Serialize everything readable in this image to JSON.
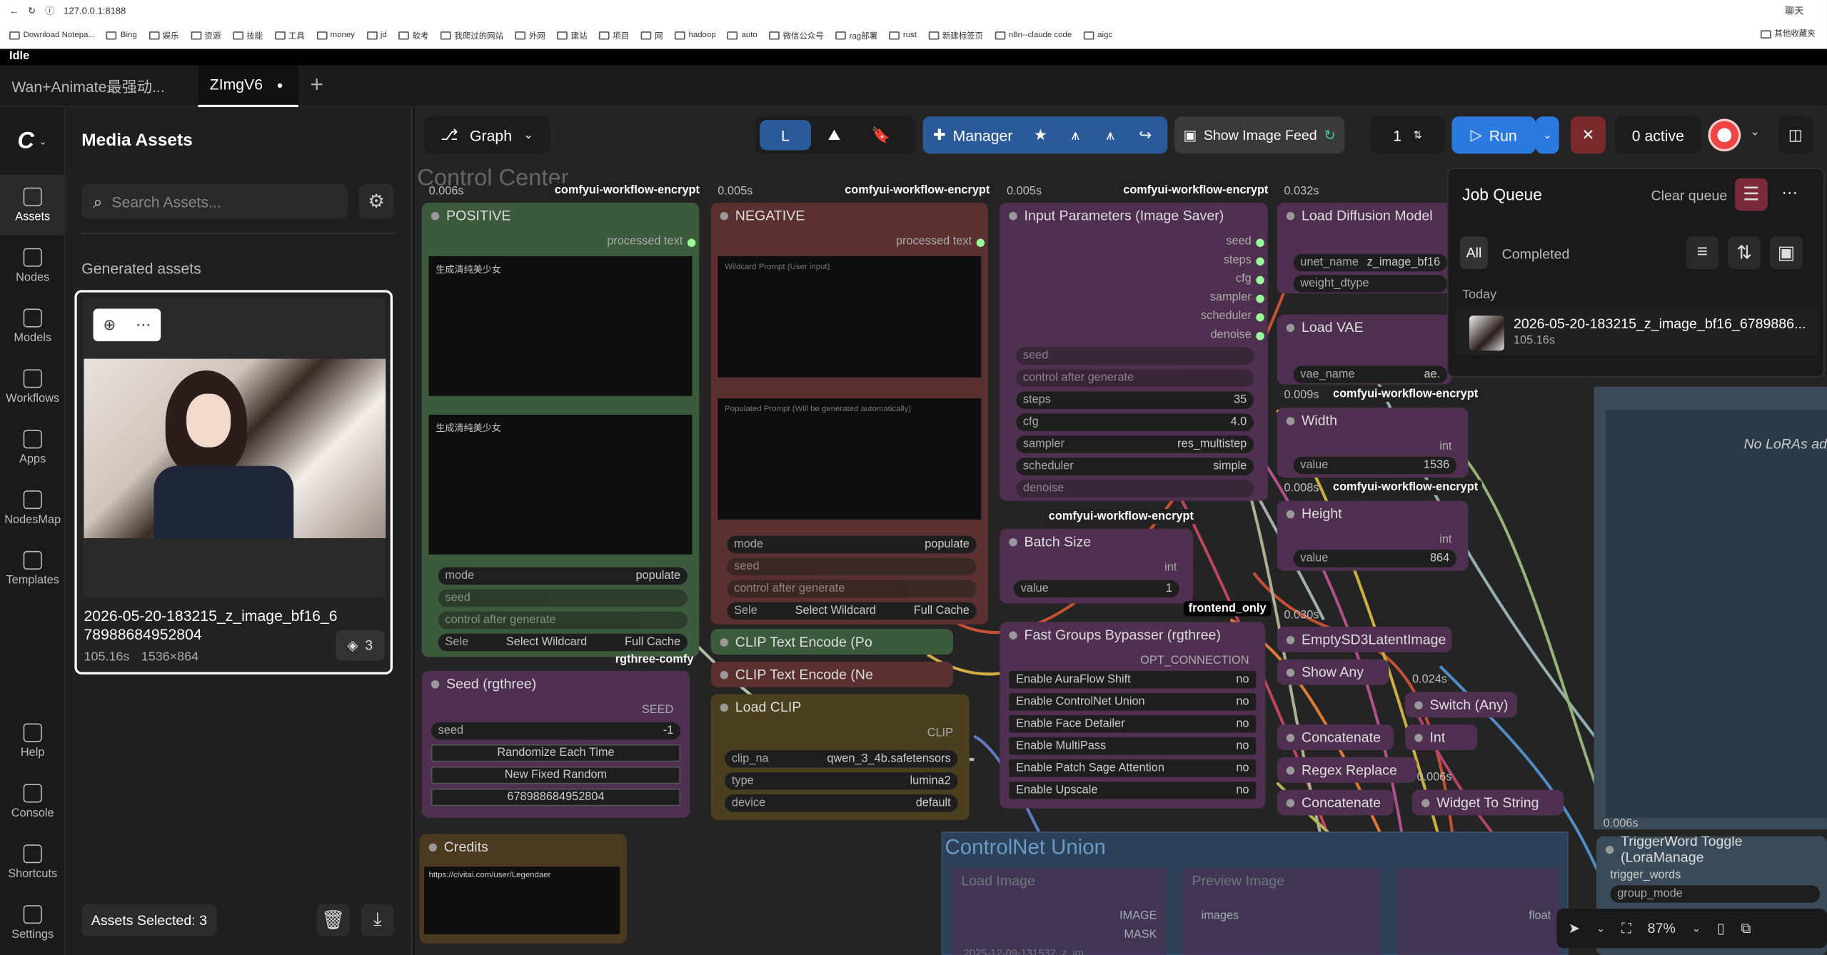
{
  "browser": {
    "url": "127.0.0.1:8188",
    "bookmarks": [
      "Download Notepa...",
      "Bing",
      "娱乐",
      "资源",
      "技能",
      "工具",
      "money",
      "jd",
      "软考",
      "我爬过的网站",
      "外网",
      "建站",
      "项目",
      "网",
      "hadoop",
      "auto",
      "微信公众号",
      "rag部署",
      "rust",
      "新建标签页",
      "n8n--claude code",
      "aigc"
    ],
    "other_bookmarks": "其他收藏夹",
    "profile": "聊天"
  },
  "status": "Idle",
  "tabs": [
    {
      "label": "Wan+Animate最强动...",
      "active": false
    },
    {
      "label": "ZImgV6",
      "active": true,
      "modified": "●"
    }
  ],
  "rail": [
    {
      "label": "Assets",
      "icon": "image-icon",
      "active": true
    },
    {
      "label": "Nodes",
      "icon": "nodes-icon"
    },
    {
      "label": "Models",
      "icon": "models-icon"
    },
    {
      "label": "Workflows",
      "icon": "workflows-icon"
    },
    {
      "label": "Apps",
      "icon": "apps-icon"
    },
    {
      "label": "NodesMap",
      "icon": "nodesmap-icon"
    },
    {
      "label": "Templates",
      "icon": "templates-icon"
    }
  ],
  "rail_bottom": [
    {
      "label": "Help",
      "icon": "help-icon"
    },
    {
      "label": "Console",
      "icon": "console-icon"
    },
    {
      "label": "Shortcuts",
      "icon": "keyboard-icon"
    },
    {
      "label": "Settings",
      "icon": "settings-icon"
    }
  ],
  "media": {
    "title": "Media Assets",
    "search_placeholder": "Search Assets...",
    "section": "Generated assets",
    "asset": {
      "name": "2026-05-20-183215_z_image_bf16_678988684952804",
      "time": "105.16s",
      "size": "1536×864",
      "count": "3"
    },
    "selected": "Assets Selected: 3"
  },
  "toolbar": {
    "graph": "Graph",
    "manager": "Manager",
    "image_feed": "Show Image Feed",
    "batch": "1",
    "run": "Run",
    "active": "0 active"
  },
  "queue": {
    "title": "Job Queue",
    "clear": "Clear queue",
    "tab_all": "All",
    "tab_completed": "Completed",
    "today": "Today",
    "job_name": "2026-05-20-183215_z_image_bf16_6789886...",
    "job_time": "105.16s"
  },
  "canvas": {
    "group_title": "Control Center",
    "controlnet_title": "ControlNet Union",
    "badge": "comfyui-workflow-encrypt",
    "positive": {
      "time": "0.006s",
      "title": "POSITIVE",
      "out": "processed text",
      "text1": "生成清纯美少女",
      "text2": "生成清纯美少女",
      "mode_label": "mode",
      "mode": "populate",
      "seed": "seed",
      "cag": "control after generate",
      "sel_label": "Sele",
      "sel": "Select Wildcard",
      "cache": "Full Cache"
    },
    "negative": {
      "time": "0.005s",
      "title": "NEGATIVE",
      "out": "processed text",
      "ph1": "Wildcard Prompt (User input)",
      "ph2": "Populated Prompt (Will be generated automatically)",
      "mode_label": "mode",
      "mode": "populate",
      "seed": "seed",
      "cag": "control after generate",
      "sel_label": "Sele",
      "sel": "Select Wildcard",
      "cache": "Full Cache"
    },
    "params": {
      "time": "0.005s",
      "title": "Input Parameters (Image Saver)",
      "outs": [
        "seed",
        "steps",
        "cfg",
        "sampler",
        "scheduler",
        "denoise"
      ],
      "seed": "seed",
      "cag": "control after generate",
      "steps": "35",
      "cfg": "4.0",
      "sampler": "res_multistep",
      "scheduler": "simple",
      "denoise": "denoise",
      "l_steps": "steps",
      "l_cfg": "cfg",
      "l_sampler": "sampler",
      "l_scheduler": "scheduler"
    },
    "diffusion": {
      "time": "0.032s",
      "title": "Load Diffusion Model",
      "unet_label": "unet_name",
      "unet": "z_image_bf16",
      "dtype": "weight_dtype"
    },
    "vae": {
      "title": "Load VAE",
      "label": "vae_name",
      "value": "ae."
    },
    "width": {
      "time": "0.009s",
      "title": "Width",
      "type": "int",
      "label": "value",
      "value": "1536"
    },
    "height": {
      "time": "0.008s",
      "title": "Height",
      "type": "int",
      "label": "value",
      "value": "864"
    },
    "batch": {
      "title": "Batch Size",
      "type": "int",
      "label": "value",
      "value": "1"
    },
    "seed_node": {
      "title": "Seed (rgthree)",
      "out": "SEED",
      "label": "seed",
      "value": "-1",
      "b1": "Randomize Each Time",
      "b2": "New Fixed Random",
      "b3": "678988684952804"
    },
    "clip_pos": "CLIP Text Encode (Po",
    "clip_neg": "CLIP Text Encode (Ne",
    "load_clip": {
      "title": "Load CLIP",
      "out": "CLIP",
      "name_label": "clip_na",
      "name": "qwen_3_4b.safetensors",
      "type_label": "type",
      "type": "lumina2",
      "dev_label": "device",
      "dev": "default"
    },
    "bypasser": {
      "title": "Fast Groups Bypasser (rgthree)",
      "out": "OPT_CONNECTION",
      "rows": [
        "Enable AuraFlow Shift",
        "Enable ControlNet Union",
        "Enable Face Detailer",
        "Enable MultiPass",
        "Enable Patch Sage Attention",
        "Enable Upscale"
      ],
      "val": "no"
    },
    "empty_latent": {
      "time": "0.030s",
      "title": "EmptySD3LatentImage"
    },
    "show_any": "Show Any",
    "switch_any": {
      "time": "0.024s",
      "title": "Switch (Any)"
    },
    "concat": "Concatenate",
    "int_node": "Int",
    "regex": "Regex Replace",
    "concat2": "Concatenate",
    "widget_str": {
      "time": "0.006s",
      "title": "Widget To String"
    },
    "credits": {
      "title": "Credits",
      "text": "https://civitai.com/user/Legendaer"
    },
    "lora": {
      "time": "0.006s",
      "title": "TriggerWord Toggle (LoraManage",
      "in": "trigger_words",
      "w": "group_mode"
    },
    "no_loras": "No LoRAs ad",
    "frontend": "frontend_only",
    "rgthree": "rgthree-comfy",
    "cn_load": "Load Image",
    "cn_preview": "Preview Image",
    "cn_image": "IMAGE",
    "cn_mask": "MASK",
    "cn_images": "images",
    "cn_float": "float",
    "cn_file": "2025-12-09-131532_z_im",
    "zoom": "87%"
  }
}
